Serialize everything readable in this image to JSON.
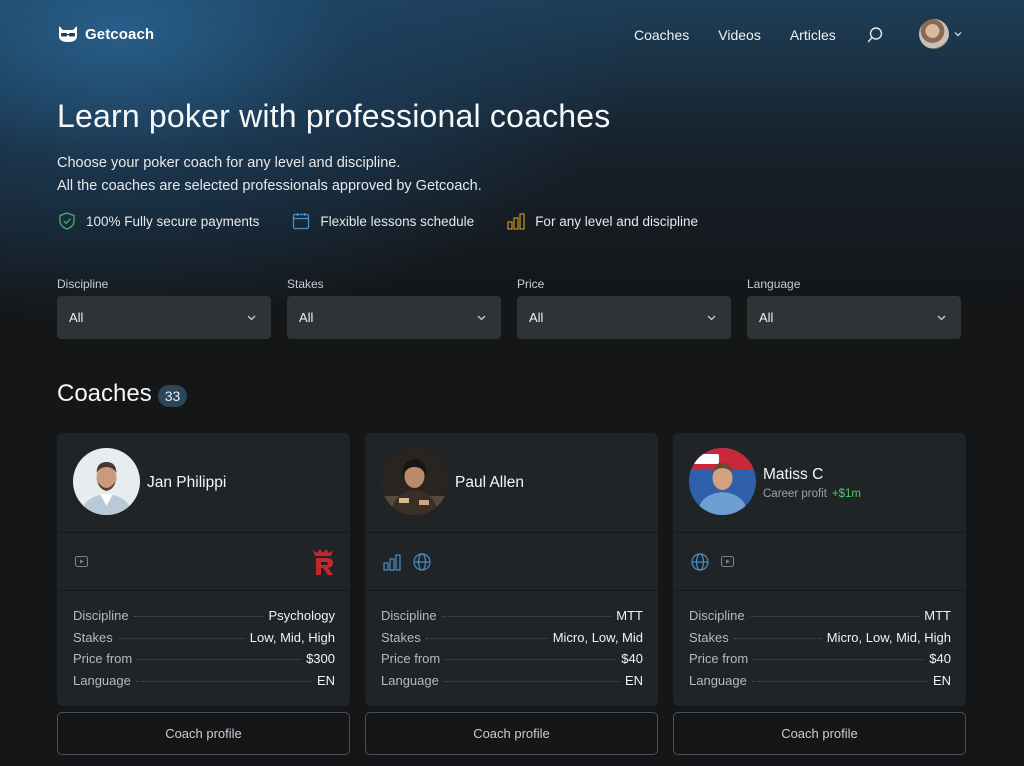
{
  "header": {
    "brand": "Getcoach",
    "nav": [
      "Coaches",
      "Videos",
      "Articles"
    ],
    "icons": {
      "search": "search-icon",
      "chevron": "chevron-down-icon"
    }
  },
  "hero": {
    "title": "Learn poker with professional coaches",
    "subtitle_line1": "Choose your poker coach for any level and discipline.",
    "subtitle_line2": "All the coaches are selected professionals approved by Getcoach.",
    "features": [
      {
        "icon": "shield-check-icon",
        "label": "100% Fully secure payments"
      },
      {
        "icon": "calendar-icon",
        "label": "Flexible lessons schedule"
      },
      {
        "icon": "bar-chart-icon",
        "label": "For any level and discipline"
      }
    ]
  },
  "filters": [
    {
      "label": "Discipline",
      "value": "All"
    },
    {
      "label": "Stakes",
      "value": "All"
    },
    {
      "label": "Price",
      "value": "All"
    },
    {
      "label": "Language",
      "value": "All"
    }
  ],
  "coaches_section": {
    "title": "Coaches",
    "count": "33"
  },
  "coaches": [
    {
      "name": "Jan Philippi",
      "career_profit_label": "",
      "career_profit_value": "",
      "icons": [
        "video-icon",
        "brand-r-logo"
      ],
      "details": {
        "discipline_label": "Discipline",
        "discipline": "Psychology",
        "stakes_label": "Stakes",
        "stakes": "Low, Mid, High",
        "price_label": "Price from",
        "price": "$300",
        "language_label": "Language",
        "language": "EN"
      },
      "button": "Coach profile"
    },
    {
      "name": "Paul Allen",
      "career_profit_label": "",
      "career_profit_value": "",
      "icons": [
        "bar-chart-icon",
        "globe-icon"
      ],
      "details": {
        "discipline_label": "Discipline",
        "discipline": "MTT",
        "stakes_label": "Stakes",
        "stakes": "Micro, Low, Mid",
        "price_label": "Price from",
        "price": "$40",
        "language_label": "Language",
        "language": "EN"
      },
      "button": "Coach profile"
    },
    {
      "name": "Matiss C",
      "career_profit_label": "Career profit",
      "career_profit_value": "+$1m",
      "icons": [
        "globe-icon",
        "video-icon"
      ],
      "details": {
        "discipline_label": "Discipline",
        "discipline": "MTT",
        "stakes_label": "Stakes",
        "stakes": "Micro, Low, Mid, High",
        "price_label": "Price from",
        "price": "$40",
        "language_label": "Language",
        "language": "EN"
      },
      "button": "Coach profile"
    }
  ],
  "colors": {
    "accent_blue": "#4a8fc0",
    "profit_green": "#52c46a",
    "brand_red": "#c0282d",
    "chart_gold": "#c8922a"
  }
}
